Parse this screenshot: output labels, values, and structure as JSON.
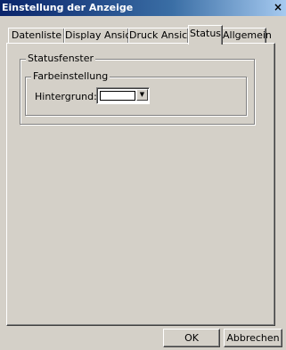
{
  "window": {
    "title": "Einstellung der Anzeige",
    "close_glyph": "×"
  },
  "tabs": [
    {
      "label": "Datenliste",
      "active": false
    },
    {
      "label": "Display Ansicht",
      "active": false
    },
    {
      "label": "Druck Ansicht",
      "active": false
    },
    {
      "label": "Status",
      "active": true
    },
    {
      "label": "Allgemein",
      "active": false
    }
  ],
  "status": {
    "group_label": "Statusfenster",
    "color_group_label": "Farbeinstellung",
    "background_label": "Hintergrund:",
    "background_color": "#ffffff",
    "dropdown_icon": "chevron-down-icon"
  },
  "buttons": {
    "ok": "OK",
    "cancel": "Abbrechen"
  }
}
